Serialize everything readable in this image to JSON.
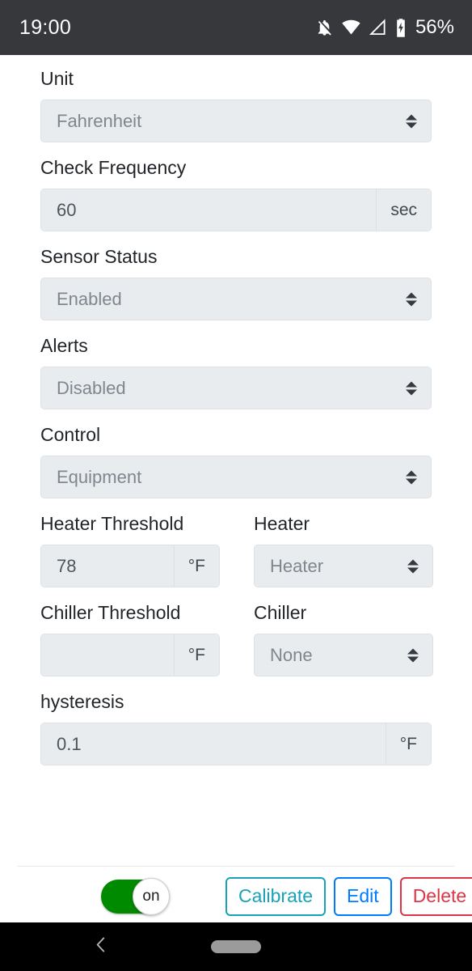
{
  "status_bar": {
    "time": "19:00",
    "battery_percent": "56%",
    "icons": [
      "notifications-off-icon",
      "wifi-icon",
      "cellular-signal-icon",
      "battery-charging-icon"
    ]
  },
  "form": {
    "unit": {
      "label": "Unit",
      "value": "Fahrenheit",
      "control": "select"
    },
    "check_frequency": {
      "label": "Check Frequency",
      "value": "60",
      "suffix": "sec",
      "control": "input"
    },
    "sensor_status": {
      "label": "Sensor Status",
      "value": "Enabled",
      "control": "select"
    },
    "alerts": {
      "label": "Alerts",
      "value": "Disabled",
      "control": "select"
    },
    "control_mode": {
      "label": "Control",
      "value": "Equipment",
      "control": "select"
    },
    "heater_threshold": {
      "label": "Heater Threshold",
      "value": "78",
      "suffix": "°F",
      "control": "input"
    },
    "heater": {
      "label": "Heater",
      "value": "Heater",
      "control": "select"
    },
    "chiller_threshold": {
      "label": "Chiller Threshold",
      "value": "",
      "suffix": "°F",
      "control": "input"
    },
    "chiller": {
      "label": "Chiller",
      "value": "None",
      "control": "select"
    },
    "hysteresis": {
      "label": "hysteresis",
      "value": "0.1",
      "suffix": "°F",
      "control": "input"
    }
  },
  "action_bar": {
    "toggle": {
      "state_label": "on",
      "on": true,
      "on_color": "#008a00"
    },
    "buttons": [
      {
        "label": "Calibrate",
        "color": "#17a2b8"
      },
      {
        "label": "Edit",
        "color": "#007bff"
      },
      {
        "label": "Delete",
        "color": "#dc3545"
      }
    ]
  },
  "nav_bar": {
    "back_icon": "chevron-left-icon",
    "home_icon": "home-pill-icon"
  }
}
